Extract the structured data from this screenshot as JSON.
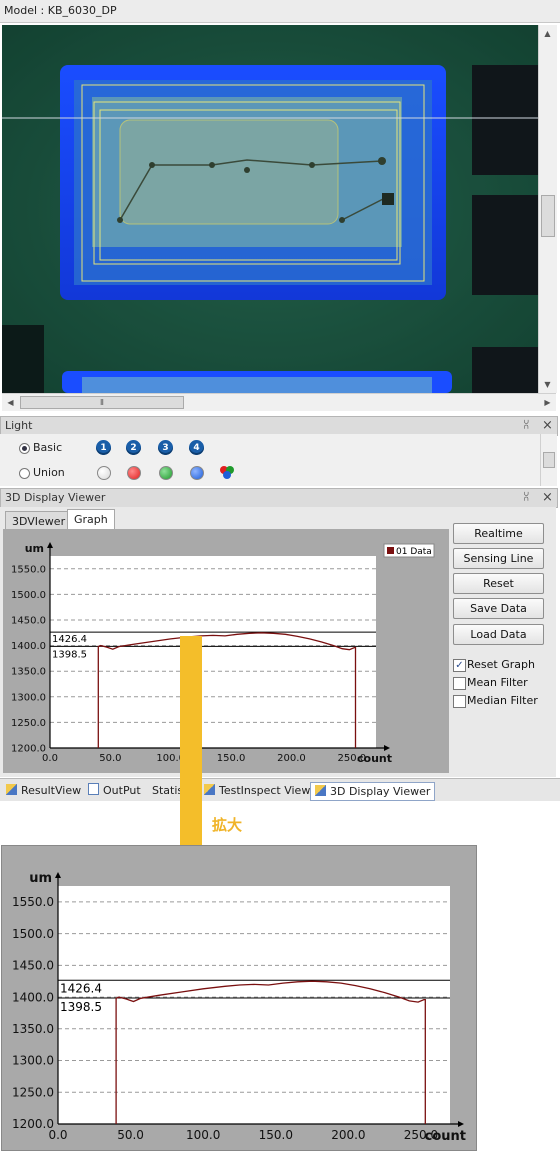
{
  "model_bar": {
    "text": "Model : KB_6030_DP"
  },
  "camera": {
    "scrollbar_thumb_glyph": "Ⅱ"
  },
  "light_panel": {
    "title": "Light",
    "pin": "⩆",
    "close": "×",
    "options": [
      {
        "label": "Basic",
        "selected": true
      },
      {
        "label": "Union",
        "selected": false
      }
    ],
    "channel_numbers": [
      "1",
      "2",
      "3",
      "4"
    ],
    "channel_colors": [
      "#d8d8d8",
      "#e02020",
      "#1f9a2c",
      "#1f5fd8"
    ]
  },
  "viewer_panel": {
    "title": "3D Display Viewer",
    "tabs": [
      {
        "label": "3DVIewer",
        "active": false
      },
      {
        "label": "Graph",
        "active": true
      }
    ],
    "buttons": [
      "Realtime",
      "Sensing Line",
      "Reset",
      "Save Data",
      "Load Data"
    ],
    "checkboxes": [
      {
        "label": "Reset Graph",
        "checked": true
      },
      {
        "label": "Mean Filter",
        "checked": false
      },
      {
        "label": "Median Filter",
        "checked": false
      }
    ]
  },
  "bottom_tabs": [
    {
      "label": "ResultView",
      "icon": "result-view-icon",
      "active": false
    },
    {
      "label": "OutPut",
      "icon": "output-icon",
      "active": false
    },
    {
      "label": "Statisti",
      "icon": "statistics-icon",
      "active": false
    },
    {
      "label": "TestInspect View",
      "icon": "test-inspect-icon",
      "active": false
    },
    {
      "label": "3D Display Viewer",
      "icon": "3d-display-icon",
      "active": true
    }
  ],
  "annotation": {
    "zoom_label": "拡大"
  },
  "chart_data": {
    "type": "line",
    "ylabel": "um",
    "xlabel": "count",
    "xlim": [
      0,
      270
    ],
    "ylim": [
      1200,
      1575
    ],
    "y_ticks": [
      "1200.0",
      "1250.0",
      "1300.0",
      "1350.0",
      "1400.0",
      "1450.0",
      "1500.0",
      "1550.0"
    ],
    "x_ticks": [
      "0.0",
      "50.0",
      "100.0",
      "150.0",
      "200.0",
      "250.0"
    ],
    "legend": "01 Data",
    "legend_color": "#7a1010",
    "upper_line": {
      "label": "1426.4",
      "value": 1426.4
    },
    "lower_line": {
      "label": "1398.5",
      "value": 1398.5
    },
    "series": [
      {
        "name": "01 Data",
        "x": [
          40,
          40,
          42,
          47,
          52,
          57,
          70,
          85,
          100,
          115,
          125,
          135,
          145,
          155,
          165,
          175,
          185,
          195,
          205,
          215,
          225,
          235,
          242,
          248,
          252,
          253,
          253
        ],
        "y": [
          1200,
          1398,
          1400,
          1397,
          1393,
          1398,
          1403,
          1408,
          1413,
          1417,
          1419,
          1420,
          1419,
          1422,
          1424,
          1425,
          1424,
          1422,
          1418,
          1413,
          1407,
          1400,
          1394,
          1392,
          1396,
          1396,
          1200
        ]
      }
    ]
  }
}
